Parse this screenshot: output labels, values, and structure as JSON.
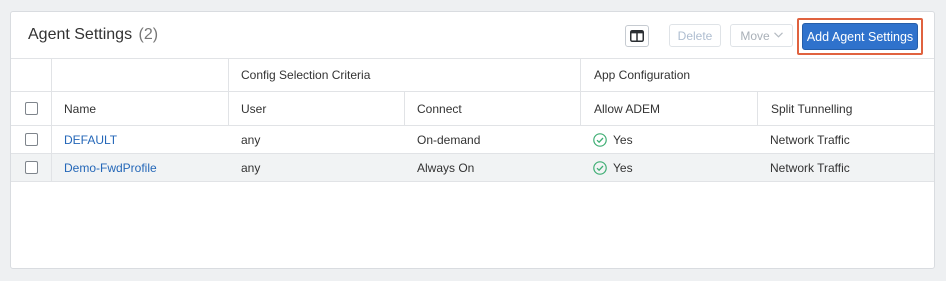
{
  "header": {
    "title": "Agent Settings",
    "count": "(2)",
    "delete_label": "Delete",
    "move_label": "Move",
    "add_label": "Add Agent Settings",
    "columns_icon": "columns-icon"
  },
  "groups": {
    "config": "Config Selection Criteria",
    "app": "App Configuration"
  },
  "columns": {
    "name": "Name",
    "user": "User",
    "connect": "Connect",
    "allow_adem": "Allow ADEM",
    "split": "Split Tunnelling"
  },
  "rows": [
    {
      "name": "DEFAULT",
      "user": "any",
      "connect": "On-demand",
      "allow_adem": "Yes",
      "split": "Network Traffic"
    },
    {
      "name": "Demo-FwdProfile",
      "user": "any",
      "connect": "Always On",
      "allow_adem": "Yes",
      "split": "Network Traffic"
    }
  ],
  "colors": {
    "accent": "#2f72cc",
    "link": "#2467b8",
    "highlight": "#e0623f",
    "success": "#3fae74"
  }
}
